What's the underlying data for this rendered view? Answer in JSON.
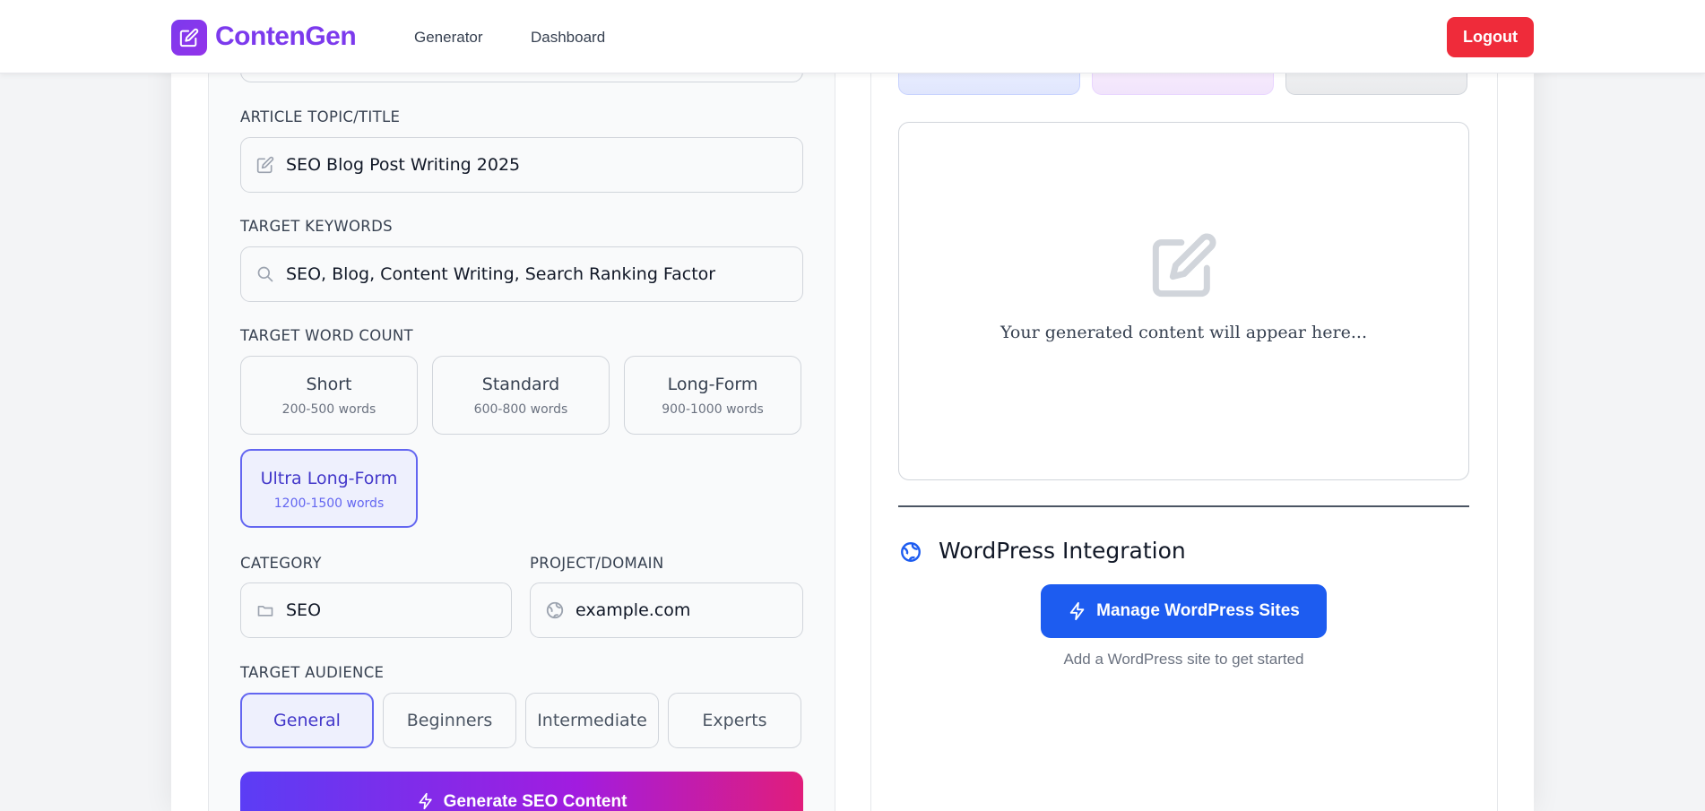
{
  "nav": {
    "brand": "ContenGen",
    "links": [
      "Generator",
      "Dashboard"
    ],
    "logout": "Logout"
  },
  "form": {
    "topic_label": "ARTICLE TOPIC/TITLE",
    "topic_value": "SEO Blog Post Writing 2025",
    "keywords_label": "TARGET KEYWORDS",
    "keywords_value": "SEO, Blog, Content Writing, Search Ranking Factor",
    "wordcount_label": "TARGET WORD COUNT",
    "wordcount_options": [
      {
        "title": "Short",
        "sub": "200-500 words"
      },
      {
        "title": "Standard",
        "sub": "600-800 words"
      },
      {
        "title": "Long-Form",
        "sub": "900-1000 words"
      },
      {
        "title": "Ultra Long-Form",
        "sub": "1200-1500 words"
      }
    ],
    "wordcount_selected": "Ultra Long-Form",
    "category_label": "CATEGORY",
    "category_value": "SEO",
    "project_label": "PROJECT/DOMAIN",
    "project_value": "example.com",
    "audience_label": "TARGET AUDIENCE",
    "audience_options": [
      "General",
      "Beginners",
      "Intermediate",
      "Experts"
    ],
    "audience_selected": "General",
    "generate_button": "Generate SEO Content"
  },
  "output": {
    "placeholder": "Your generated content will appear here..."
  },
  "wordpress": {
    "title": "WordPress Integration",
    "button": "Manage WordPress Sites",
    "hint": "Add a WordPress site to get started"
  },
  "colors": {
    "brand": "#7c3aed",
    "logout": "#ef2b3a",
    "selected_border": "#6366f1",
    "wp_button": "#1d5cf0"
  },
  "icons": [
    "edit-icon",
    "search-icon",
    "folder-icon",
    "globe-icon",
    "bolt-icon",
    "edit-large-icon"
  ]
}
